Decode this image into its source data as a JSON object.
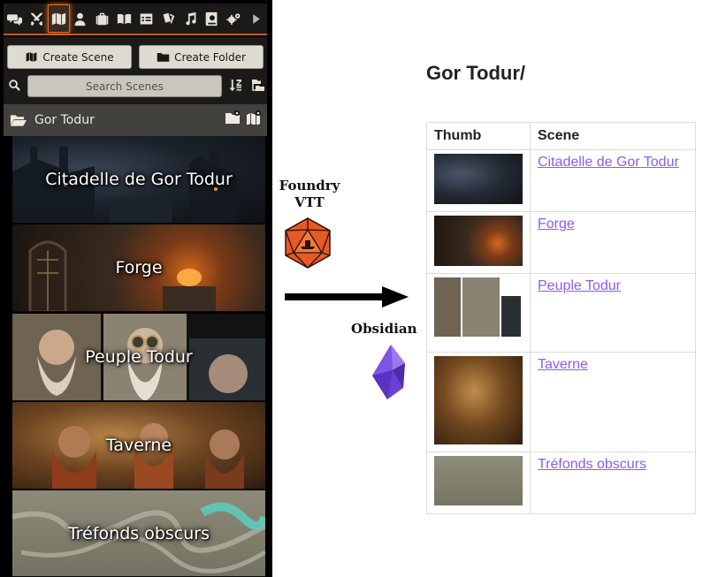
{
  "sidebar": {
    "tabs": [
      {
        "name": "chat",
        "icon": "chat-bubbles-icon"
      },
      {
        "name": "combat",
        "icon": "crossed-swords-icon"
      },
      {
        "name": "scenes",
        "icon": "map-icon",
        "active": true
      },
      {
        "name": "actors",
        "icon": "user-icon"
      },
      {
        "name": "items",
        "icon": "suitcase-icon"
      },
      {
        "name": "journal",
        "icon": "open-book-icon"
      },
      {
        "name": "tables",
        "icon": "table-icon"
      },
      {
        "name": "cards",
        "icon": "cards-icon"
      },
      {
        "name": "playlists",
        "icon": "music-note-icon"
      },
      {
        "name": "compendium",
        "icon": "atlas-icon"
      },
      {
        "name": "settings",
        "icon": "gears-icon"
      }
    ],
    "create_scene_label": "Create Scene",
    "create_folder_label": "Create Folder",
    "search_placeholder": "Search Scenes",
    "folder": {
      "name": "Gor Todur"
    },
    "scenes": [
      {
        "name": "Citadelle de Gor Todur"
      },
      {
        "name": "Forge"
      },
      {
        "name": "Peuple Todur"
      },
      {
        "name": "Taverne"
      },
      {
        "name": "Tréfonds obscurs"
      }
    ],
    "accent_color": "#c8581a"
  },
  "middle": {
    "foundry_label": "Foundry VTT",
    "obsidian_label": "Obsidian"
  },
  "note": {
    "title": "Gor Todur/",
    "table": {
      "headers": [
        "Thumb",
        "Scene"
      ],
      "rows": [
        {
          "scene": "Citadelle de Gor Todur"
        },
        {
          "scene": "Forge"
        },
        {
          "scene": "Peuple Todur"
        },
        {
          "scene": "Taverne"
        },
        {
          "scene": "Tréfonds obscurs"
        }
      ]
    },
    "link_color": "#8a5cf5"
  }
}
